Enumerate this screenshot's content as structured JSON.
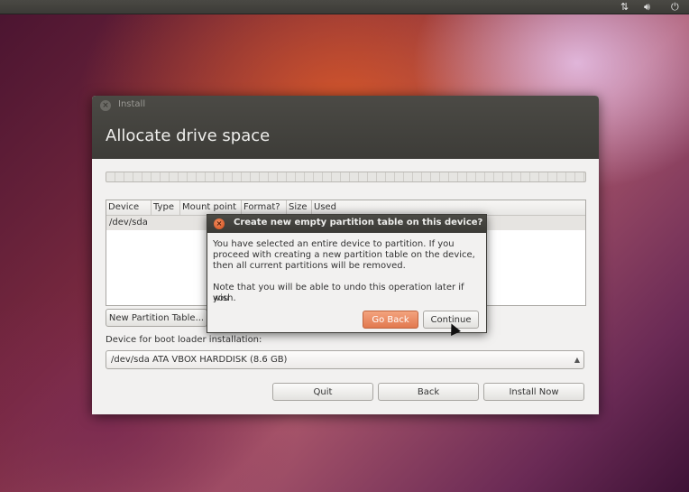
{
  "panel": {
    "icons": [
      "network-arrows-icon",
      "volume-icon",
      "power-icon"
    ]
  },
  "window": {
    "title": "Install",
    "page_title": "Allocate drive space"
  },
  "table": {
    "columns": [
      "Device",
      "Type",
      "Mount point",
      "Format?",
      "Size",
      "Used"
    ],
    "rows": [
      {
        "device": "/dev/sda"
      }
    ]
  },
  "buttons": {
    "new_partition_table": "New Partition Table...",
    "quit": "Quit",
    "back": "Back",
    "install_now": "Install Now"
  },
  "bootloader": {
    "label": "Device for boot loader installation:",
    "selected": "/dev/sda ATA VBOX HARDDISK (8.6 GB)"
  },
  "dialog": {
    "title": "Create new empty partition table on this device?",
    "message_lines": [
      "You have selected an entire device to partition. If you",
      "proceed with creating a new partition table on the device,",
      "then all current partitions will be removed."
    ],
    "note_lines": [
      "Note that you will be able to undo this operation later if you",
      "wish."
    ],
    "go_back": "Go Back",
    "continue": "Continue"
  },
  "colors": {
    "accent": "#e2794f",
    "titlebar": "#3d3c38"
  }
}
